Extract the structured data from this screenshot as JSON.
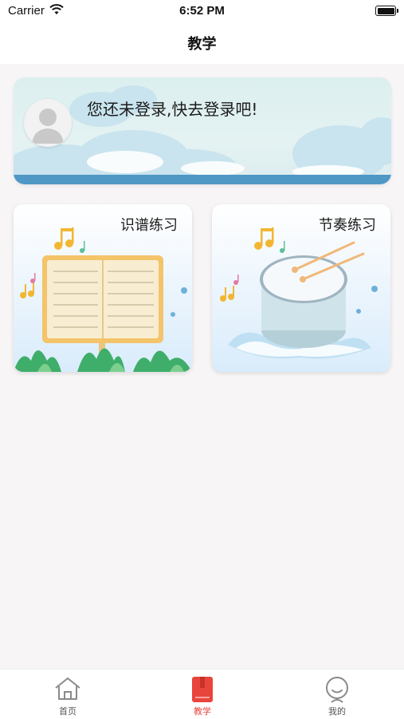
{
  "status_bar": {
    "carrier": "Carrier",
    "time": "6:52 PM"
  },
  "nav": {
    "title": "教学"
  },
  "login_banner": {
    "text": "您还未登录,快去登录吧!",
    "icon": "avatar-placeholder-icon"
  },
  "cards": [
    {
      "title": "识谱练习",
      "icon": "music-score-stand-icon"
    },
    {
      "title": "节奏练习",
      "icon": "drum-icon"
    }
  ],
  "tab_bar": {
    "active_color": "#e8453c",
    "items": [
      {
        "label": "首页",
        "icon": "home-icon",
        "active": false
      },
      {
        "label": "教学",
        "icon": "book-icon",
        "active": true
      },
      {
        "label": "我的",
        "icon": "profile-icon",
        "active": false
      }
    ]
  }
}
